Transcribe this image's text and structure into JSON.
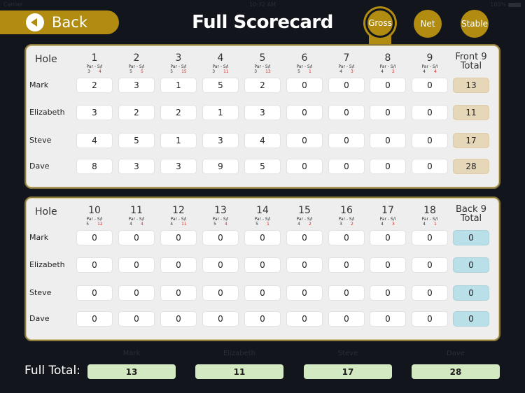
{
  "status_bar": {
    "carrier": "Carrier",
    "time": "10:32 AM",
    "battery": "100%"
  },
  "header": {
    "back_label": "Back",
    "title": "Full Scorecard",
    "modes": [
      {
        "label": "Gross",
        "selected": true
      },
      {
        "label": "Net",
        "selected": false
      },
      {
        "label": "Stable",
        "selected": false
      }
    ]
  },
  "colors": {
    "accent": "#b18c10",
    "background": "#12151c",
    "front_total": "#e6d7b8",
    "back_total": "#b9dfe9",
    "full_total": "#d3e9c1",
    "stroke_index": "#e02424"
  },
  "labels": {
    "hole": "Hole",
    "par_si": "Par  -  S/I",
    "full_total": "Full Total:"
  },
  "front_nine": {
    "total_label_1": "Front 9",
    "total_label_2": "Total",
    "holes": [
      {
        "num": "1",
        "par": "3",
        "si": "4"
      },
      {
        "num": "2",
        "par": "5",
        "si": "5"
      },
      {
        "num": "3",
        "par": "5",
        "si": "15"
      },
      {
        "num": "4",
        "par": "3",
        "si": "11"
      },
      {
        "num": "5",
        "par": "3",
        "si": "13"
      },
      {
        "num": "6",
        "par": "5",
        "si": "1"
      },
      {
        "num": "7",
        "par": "4",
        "si": "3"
      },
      {
        "num": "8",
        "par": "4",
        "si": "2"
      },
      {
        "num": "9",
        "par": "4",
        "si": "4"
      }
    ],
    "players": [
      {
        "name": "Mark",
        "scores": [
          "2",
          "3",
          "1",
          "5",
          "2",
          "0",
          "0",
          "0",
          "0"
        ],
        "total": "13"
      },
      {
        "name": "Elizabeth",
        "scores": [
          "3",
          "2",
          "2",
          "1",
          "3",
          "0",
          "0",
          "0",
          "0"
        ],
        "total": "11"
      },
      {
        "name": "Steve",
        "scores": [
          "4",
          "5",
          "1",
          "3",
          "4",
          "0",
          "0",
          "0",
          "0"
        ],
        "total": "17"
      },
      {
        "name": "Dave",
        "scores": [
          "8",
          "3",
          "3",
          "9",
          "5",
          "0",
          "0",
          "0",
          "0"
        ],
        "total": "28"
      }
    ]
  },
  "back_nine": {
    "total_label_1": "Back 9",
    "total_label_2": "Total",
    "holes": [
      {
        "num": "10",
        "par": "5",
        "si": "12"
      },
      {
        "num": "11",
        "par": "4",
        "si": "4"
      },
      {
        "num": "12",
        "par": "4",
        "si": "11"
      },
      {
        "num": "13",
        "par": "5",
        "si": "4"
      },
      {
        "num": "14",
        "par": "5",
        "si": "1"
      },
      {
        "num": "15",
        "par": "4",
        "si": "2"
      },
      {
        "num": "16",
        "par": "3",
        "si": "2"
      },
      {
        "num": "17",
        "par": "4",
        "si": "3"
      },
      {
        "num": "18",
        "par": "4",
        "si": "1"
      }
    ],
    "players": [
      {
        "name": "Mark",
        "scores": [
          "0",
          "0",
          "0",
          "0",
          "0",
          "0",
          "0",
          "0",
          "0"
        ],
        "total": "0"
      },
      {
        "name": "Elizabeth",
        "scores": [
          "0",
          "0",
          "0",
          "0",
          "0",
          "0",
          "0",
          "0",
          "0"
        ],
        "total": "0"
      },
      {
        "name": "Steve",
        "scores": [
          "0",
          "0",
          "0",
          "0",
          "0",
          "0",
          "0",
          "0",
          "0"
        ],
        "total": "0"
      },
      {
        "name": "Dave",
        "scores": [
          "0",
          "0",
          "0",
          "0",
          "0",
          "0",
          "0",
          "0",
          "0"
        ],
        "total": "0"
      }
    ]
  },
  "full_total": [
    {
      "name": "Mark",
      "total": "13"
    },
    {
      "name": "Elizabeth",
      "total": "11"
    },
    {
      "name": "Steve",
      "total": "17"
    },
    {
      "name": "Dave",
      "total": "28"
    }
  ]
}
